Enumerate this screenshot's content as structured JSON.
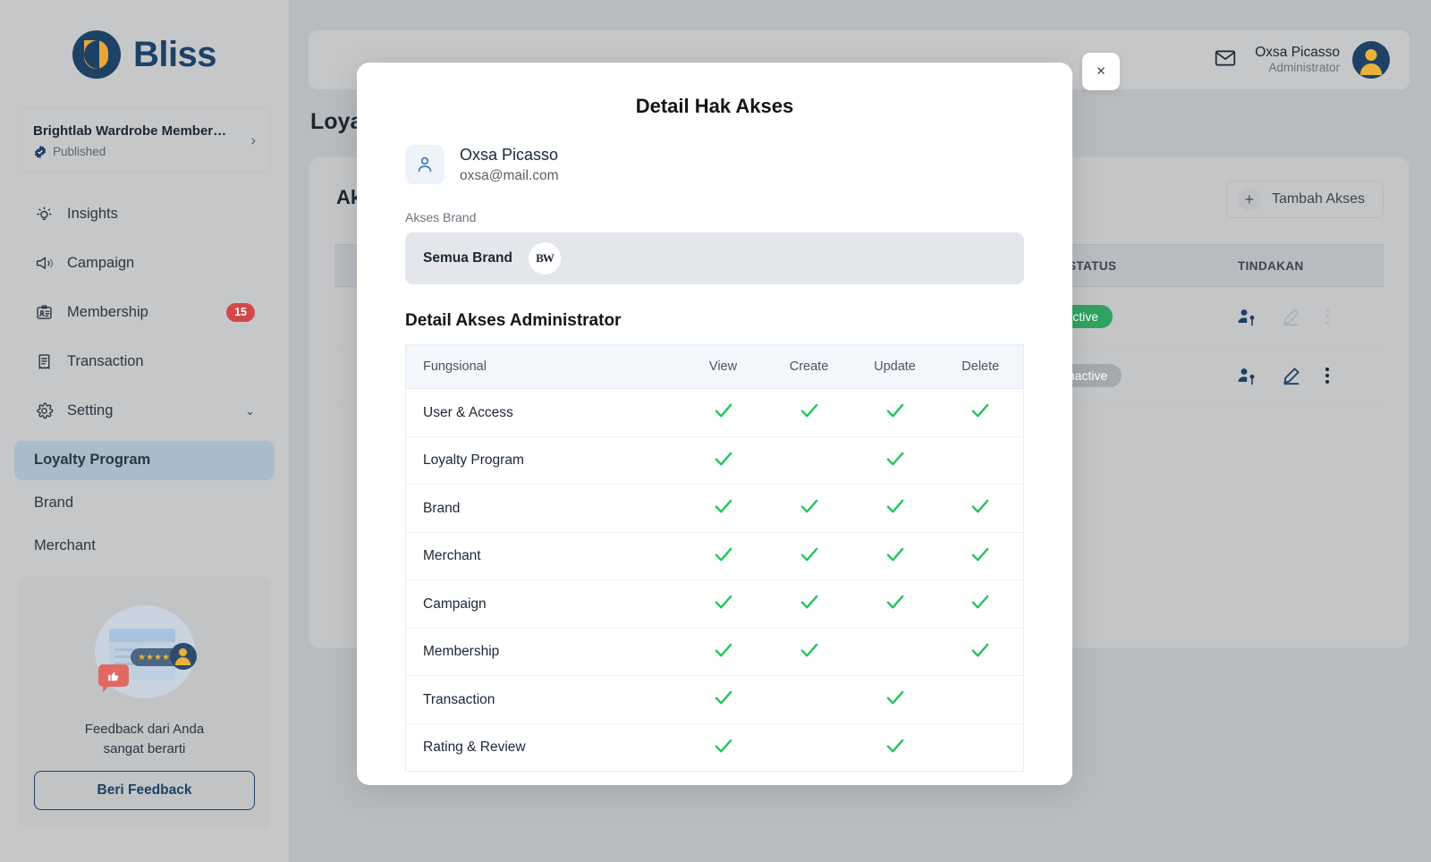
{
  "app": {
    "logo_text": "Bliss"
  },
  "sidebar": {
    "brand_card": {
      "title": "Brightlab Wardrobe Member…",
      "status": "Published",
      "chevron": "›"
    },
    "nav": [
      {
        "label": "Insights",
        "icon": "insights-icon",
        "badge": null
      },
      {
        "label": "Campaign",
        "icon": "campaign-icon",
        "badge": null
      },
      {
        "label": "Membership",
        "icon": "membership-icon",
        "badge": "15"
      },
      {
        "label": "Transaction",
        "icon": "transaction-icon",
        "badge": null
      },
      {
        "label": "Setting",
        "icon": "gear-icon",
        "badge": null,
        "chevron": "⌄"
      }
    ],
    "sub_items": [
      {
        "label": "Loyalty Program",
        "active": true
      },
      {
        "label": "Brand",
        "active": false
      },
      {
        "label": "Merchant",
        "active": false
      }
    ],
    "feedback": {
      "stars": "★★★★★",
      "thumb": "👍",
      "text_line1": "Feedback dari Anda",
      "text_line2": "sangat berarti",
      "button": "Beri Feedback"
    }
  },
  "topbar": {
    "user_name": "Oxsa Picasso",
    "user_role": "Administrator"
  },
  "page": {
    "title": "Loyalty Program",
    "card_heading": "Akses Pengguna",
    "add_button": "Tambah Akses",
    "add_plus": "+",
    "table_headers": {
      "status": "STATUS",
      "action": "TINDAKAN"
    },
    "rows": [
      {
        "status": "Active",
        "status_type": "active"
      },
      {
        "status": "Inactive",
        "status_type": "inactive"
      }
    ]
  },
  "modal": {
    "title": "Detail Hak Akses",
    "close_label": "✕",
    "user": {
      "name": "Oxsa Picasso",
      "email": "oxsa@mail.com"
    },
    "brand_field_label": "Akses Brand",
    "brand_value": "Semua Brand",
    "brand_initials": "BW",
    "section_title": "Detail Akses Administrator",
    "table": {
      "headers": [
        "Fungsional",
        "View",
        "Create",
        "Update",
        "Delete"
      ],
      "check_glyph": "✓",
      "rows": [
        {
          "name": "User & Access",
          "view": true,
          "create": true,
          "update": true,
          "delete": true
        },
        {
          "name": "Loyalty Program",
          "view": true,
          "create": false,
          "update": true,
          "delete": false
        },
        {
          "name": "Brand",
          "view": true,
          "create": true,
          "update": true,
          "delete": true
        },
        {
          "name": "Merchant",
          "view": true,
          "create": true,
          "update": true,
          "delete": true
        },
        {
          "name": "Campaign",
          "view": true,
          "create": true,
          "update": true,
          "delete": true
        },
        {
          "name": "Membership",
          "view": true,
          "create": true,
          "update": false,
          "delete": true
        },
        {
          "name": "Transaction",
          "view": true,
          "create": false,
          "update": true,
          "delete": false
        },
        {
          "name": "Rating & Review",
          "view": true,
          "create": false,
          "update": true,
          "delete": false
        }
      ]
    }
  },
  "colors": {
    "brand_navy": "#1d4266",
    "brand_gold": "#e8a63a",
    "check_green": "#22c55e",
    "status_active": "#2fa360",
    "status_inactive": "#a5a9ac",
    "badge_red": "#d24848",
    "active_nav": "#a8bdc9"
  }
}
